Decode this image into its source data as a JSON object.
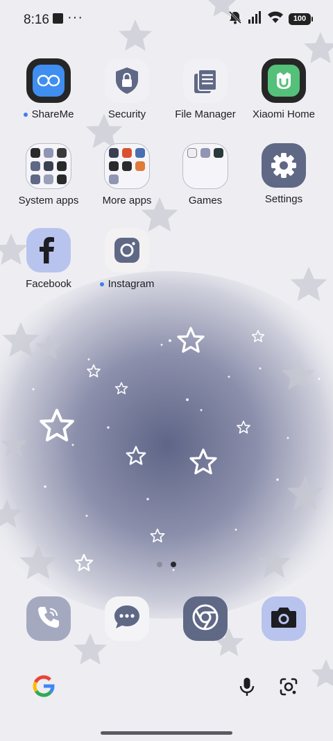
{
  "status_bar": {
    "time": "8:16",
    "battery": "100",
    "indicators": [
      "recording-square-icon",
      "more-notifications-icon",
      "silent-icon",
      "signal-icon",
      "wifi-icon",
      "battery-icon"
    ]
  },
  "apps": [
    {
      "label": "ShareMe",
      "icon": "shareme-icon",
      "new": true
    },
    {
      "label": "Security",
      "icon": "security-shield-icon",
      "new": false
    },
    {
      "label": "File Manager",
      "icon": "file-manager-icon",
      "new": false
    },
    {
      "label": "Xiaomi Home",
      "icon": "xiaomi-home-icon",
      "new": false
    },
    {
      "label": "System apps",
      "icon": "folder-icon",
      "new": false
    },
    {
      "label": "More apps",
      "icon": "folder-icon",
      "new": false
    },
    {
      "label": "Games",
      "icon": "folder-icon",
      "new": false
    },
    {
      "label": "Settings",
      "icon": "gear-icon",
      "new": false
    },
    {
      "label": "Facebook",
      "icon": "facebook-icon",
      "new": false
    },
    {
      "label": "Instagram",
      "icon": "instagram-icon",
      "new": true
    }
  ],
  "pager": {
    "pages": 2,
    "current": 2
  },
  "dock": [
    {
      "name": "phone",
      "icon": "phone-icon"
    },
    {
      "name": "messages",
      "icon": "messages-icon"
    },
    {
      "name": "chrome",
      "icon": "chrome-icon"
    },
    {
      "name": "camera",
      "icon": "camera-icon"
    }
  ],
  "search_bar": {
    "icons": [
      "google-g-icon",
      "microphone-icon",
      "google-lens-icon"
    ]
  },
  "colors": {
    "accent_dot": "#3d7df2",
    "icon_slate": "#5f6885",
    "icon_lavender": "#b8c4ee",
    "wallpaper_glow": "#6a6f92"
  }
}
